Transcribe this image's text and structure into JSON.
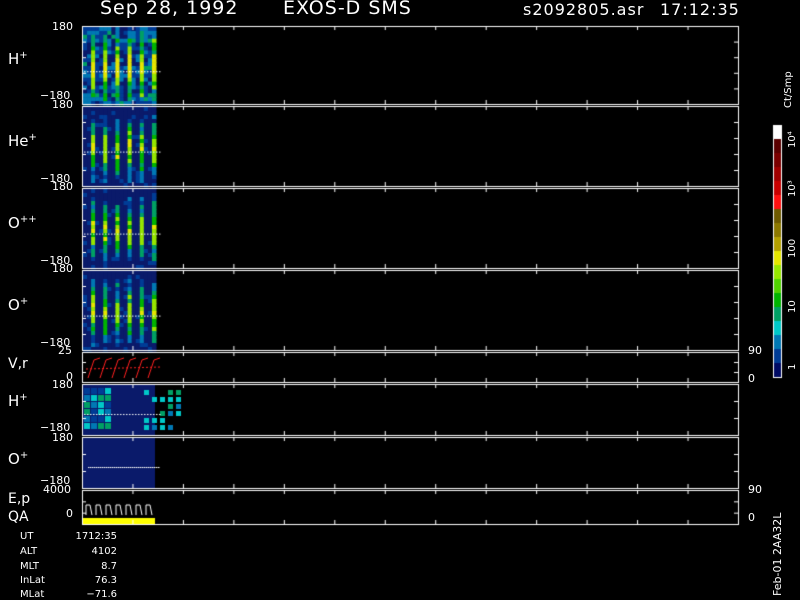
{
  "header": {
    "date": "Sep 28, 1992",
    "instrument": "EXOS-D SMS",
    "file": "s2092805.asr",
    "time": "17:12:35"
  },
  "colors": {
    "background": "#000000",
    "frame": "#ffffff",
    "vr_trace": "#ff2020",
    "qa_bar": "#ffff00",
    "panel_bg": "#0a1a6a"
  },
  "panels": [
    {
      "id": "h_plus",
      "species": "H",
      "charge": "+",
      "ytop": "180",
      "ybot": "−180"
    },
    {
      "id": "he_plus",
      "species": "He",
      "charge": "+",
      "ytop": "180",
      "ybot": "−180"
    },
    {
      "id": "o_plus_plus",
      "species": "O",
      "charge": "++",
      "ytop": "180",
      "ybot": "−180"
    },
    {
      "id": "o_plus",
      "species": "O",
      "charge": "+",
      "ytop": "180",
      "ybot": "−180"
    }
  ],
  "vr_panel": {
    "label": "V,r",
    "ytop": "25",
    "ybot": "0",
    "right_top": "90",
    "right_bot": "0"
  },
  "h_plus_small": {
    "species": "H",
    "charge": "+",
    "ytop": "180",
    "ybot": "−180"
  },
  "o_plus_small": {
    "species": "O",
    "charge": "+",
    "ytop": "180",
    "ybot": "−180"
  },
  "ep_panel": {
    "label1": "E,p",
    "label2": "QA",
    "ytop": "4000",
    "ybot": "0",
    "right_top": "90",
    "right_bot": "0"
  },
  "colorbar": {
    "unit": "Ct/Smp",
    "labels": [
      "10⁴",
      "10³",
      "100",
      "10",
      "1"
    ],
    "colors": [
      "#ffffff",
      "#5a0000",
      "#7a0000",
      "#a00000",
      "#c80000",
      "#ff1010",
      "#6e5a00",
      "#8c7800",
      "#b4a000",
      "#e6e600",
      "#96e600",
      "#50d200",
      "#00b400",
      "#00a064",
      "#00c8c8",
      "#0078b4",
      "#003c96",
      "#000a64"
    ]
  },
  "info": [
    {
      "key": "UT",
      "value": "1712:35"
    },
    {
      "key": "ALT",
      "value": "4102"
    },
    {
      "key": "MLT",
      "value": "8.7"
    },
    {
      "key": "InLat",
      "value": "76.3"
    },
    {
      "key": "MLat",
      "value": "−71.6"
    }
  ],
  "footer_code": "Feb-01 2AA32L",
  "chart_data": {
    "type": "heatmap",
    "title": "Sep 28, 1992   EXOS-D SMS",
    "panels": [
      "H+",
      "He+",
      "O++",
      "O+",
      "V,r",
      "H+",
      "O+",
      "E,p QA"
    ],
    "ion_panel_ylim": [
      -180,
      180
    ],
    "vr_ylim": [
      0,
      25
    ],
    "ep_ylim": [
      0,
      4000
    ],
    "right_axis_range": [
      0,
      90
    ],
    "spin_bursts": 6,
    "colorbar_range": [
      1,
      10000
    ],
    "colorbar_scale": "log",
    "colorbar_unit": "Ct/Smp"
  }
}
